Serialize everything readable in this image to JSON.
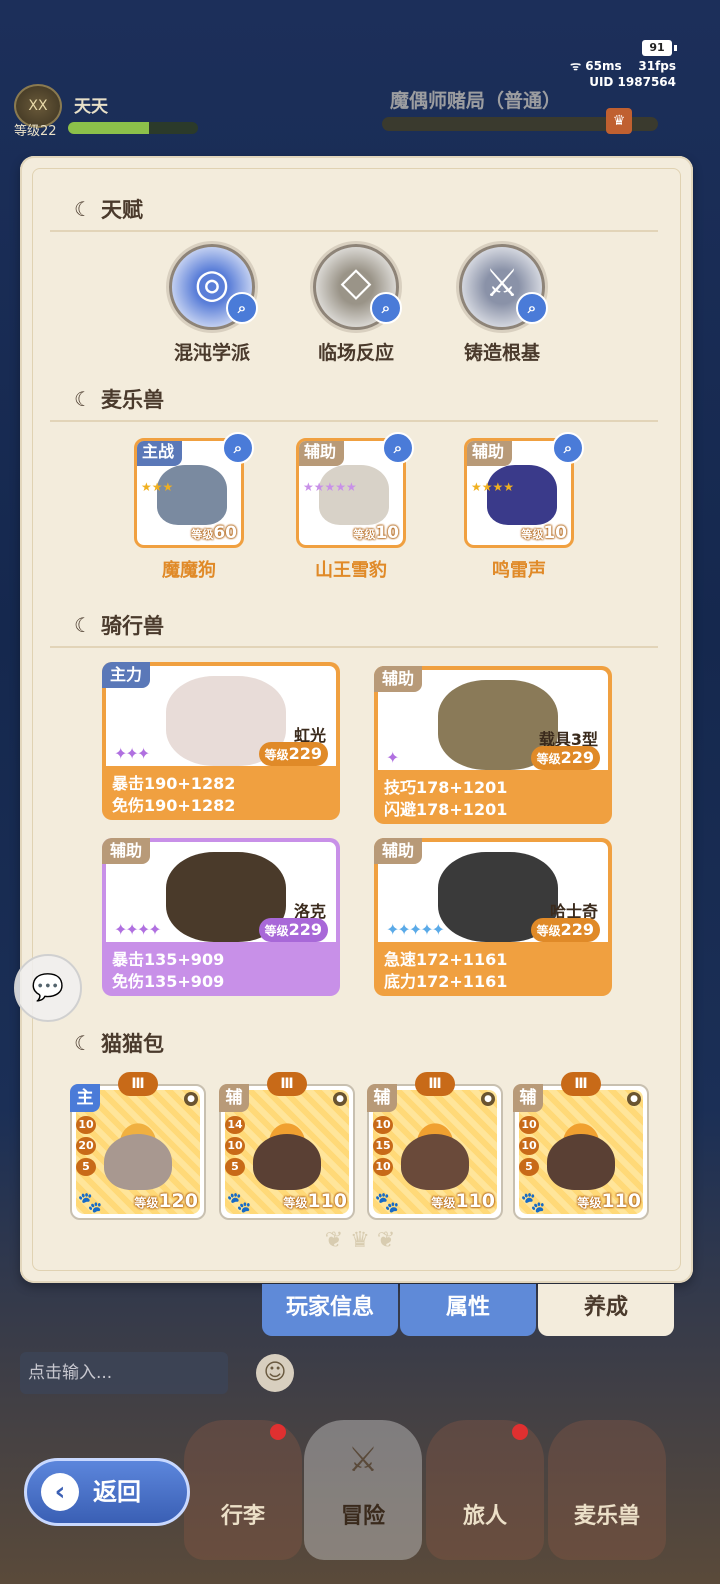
{
  "status": {
    "battery": "91",
    "ping": "65ms",
    "fps": "31fps",
    "uid": "UID 1987564"
  },
  "player": {
    "emblem": "XX",
    "name": "天天",
    "level_label": "等级22",
    "xp_fraction": 0.62
  },
  "map": {
    "title": "魔偶师赌局（普通）"
  },
  "sections": {
    "talent": "天赋",
    "pets": "麦乐兽",
    "mounts": "骑行兽",
    "cats": "猫猫包"
  },
  "talents": [
    {
      "name": "混沌学派",
      "icon": "chaos-swirl-icon",
      "color": "#5a7ed8"
    },
    {
      "name": "临场反应",
      "icon": "crystal-shield-icon",
      "color": "#9a9488"
    },
    {
      "name": "铸造根基",
      "icon": "sword-icon",
      "color": "#8a92a8"
    }
  ],
  "pets": [
    {
      "tag": "主战",
      "tag_color": "#5a78b8",
      "level_prefix": "等级",
      "level": "60",
      "name": "魔魔狗",
      "stars": "★★★",
      "art_color": "#7a8aa0"
    },
    {
      "tag": "辅助",
      "tag_color": "#b89a78",
      "level_prefix": "等级",
      "level": "10",
      "name": "山王雪豹",
      "stars": "★★★★★",
      "art_color": "#d8d2c8"
    },
    {
      "tag": "辅助",
      "tag_color": "#b89a78",
      "level_prefix": "等级",
      "level": "10",
      "name": "鸣雷声",
      "stars": "★★★★",
      "art_color": "#3a3a8a"
    }
  ],
  "mounts": [
    {
      "tag": "主力",
      "tag_color": "#5a78b8",
      "name": "虹光",
      "level_prefix": "等级",
      "level": "229",
      "stars": "✦✦✦",
      "star_color": "#b070e0",
      "stat1": "暴击190+1282",
      "stat2": "免伤190+1282",
      "bg": "#f0a040",
      "lvl_bg": "#e08a28",
      "art_color": "#e8dcd8"
    },
    {
      "tag": "辅助",
      "tag_color": "#b89a78",
      "name": "载具3型",
      "level_prefix": "等级",
      "level": "229",
      "stars": "✦",
      "star_color": "#b070e0",
      "stat1": "技巧178+1201",
      "stat2": "闪避178+1201",
      "bg": "#f0a040",
      "lvl_bg": "#e08a28",
      "art_color": "#8a7a58"
    },
    {
      "tag": "辅助",
      "tag_color": "#b89a78",
      "name": "洛克",
      "level_prefix": "等级",
      "level": "229",
      "stars": "✦✦✦✦",
      "star_color": "#b070e0",
      "stat1": "暴击135+909",
      "stat2": "免伤135+909",
      "bg": "#c890e8",
      "lvl_bg": "#a868d8",
      "art_color": "#4a3a2a"
    },
    {
      "tag": "辅助",
      "tag_color": "#b89a78",
      "name": "哈士奇",
      "level_prefix": "等级",
      "level": "229",
      "stars": "✦✦✦✦✦",
      "star_color": "#5aaae8",
      "stat1": "急速172+1161",
      "stat2": "底力172+1161",
      "bg": "#f0a040",
      "lvl_bg": "#e08a28",
      "art_color": "#3a3a3a"
    }
  ],
  "cats": [
    {
      "role": "主",
      "role_color": "#4a7bd8",
      "rank": "Ⅲ",
      "nums": [
        "10",
        "20",
        "5"
      ],
      "level_prefix": "等级",
      "level": "120",
      "face_color": "#a89890"
    },
    {
      "role": "辅",
      "role_color": "#b89a78",
      "rank": "Ⅲ",
      "nums": [
        "14",
        "10",
        "5"
      ],
      "level_prefix": "等级",
      "level": "110",
      "face_color": "#5a4034"
    },
    {
      "role": "辅",
      "role_color": "#b89a78",
      "rank": "Ⅲ",
      "nums": [
        "10",
        "15",
        "10"
      ],
      "level_prefix": "等级",
      "level": "110",
      "face_color": "#6a4a3a"
    },
    {
      "role": "辅",
      "role_color": "#b89a78",
      "rank": "Ⅲ",
      "nums": [
        "10",
        "10",
        "5"
      ],
      "level_prefix": "等级",
      "level": "110",
      "face_color": "#5a4034"
    }
  ],
  "tabs": [
    {
      "label": "玩家信息",
      "active": false
    },
    {
      "label": "属性",
      "active": false
    },
    {
      "label": "养成",
      "active": true
    }
  ],
  "chat": {
    "placeholder": "点击输入..."
  },
  "nav": [
    {
      "label": "行李",
      "badge": true
    },
    {
      "label": "冒险",
      "badge": false
    },
    {
      "label": "旅人",
      "badge": true
    },
    {
      "label": "麦乐兽",
      "badge": false
    }
  ],
  "back": {
    "label": "返回"
  }
}
